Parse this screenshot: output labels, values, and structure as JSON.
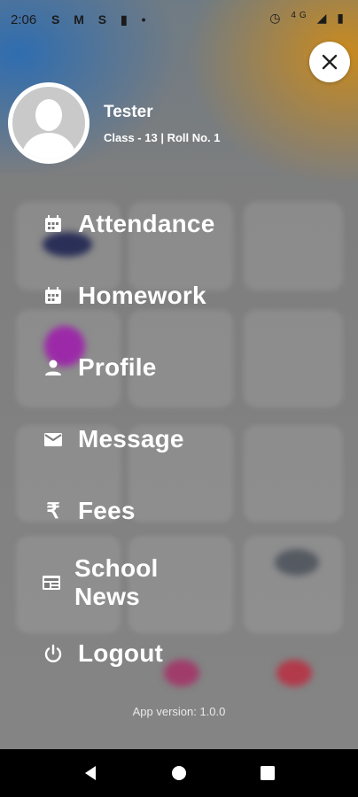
{
  "status_bar": {
    "time": "2:06",
    "left_icons": [
      "S",
      "M",
      "S",
      "sd-card-icon",
      "dot-icon"
    ],
    "right_icons": [
      "alarm-icon",
      "4G",
      "signal-icon",
      "battery-icon"
    ]
  },
  "close_icon": "close-icon",
  "profile": {
    "name": "Tester",
    "class_info": "Class - 13  |  Roll No. 1"
  },
  "menu": {
    "items": [
      {
        "label": "Attendance",
        "icon": "calendar-icon"
      },
      {
        "label": "Homework",
        "icon": "calendar-icon"
      },
      {
        "label": "Profile",
        "icon": "person-icon"
      },
      {
        "label": "Message",
        "icon": "mail-icon"
      },
      {
        "label": "Fees",
        "icon": "rupee-icon"
      },
      {
        "label": "School News",
        "icon": "news-icon"
      },
      {
        "label": "Logout",
        "icon": "power-icon"
      }
    ]
  },
  "app_version": "App version: 1.0.0",
  "colors": {
    "overlay": "#858585",
    "accent_blue": "#2f6db0",
    "accent_orange": "#c98a1e",
    "text": "#ffffff"
  }
}
